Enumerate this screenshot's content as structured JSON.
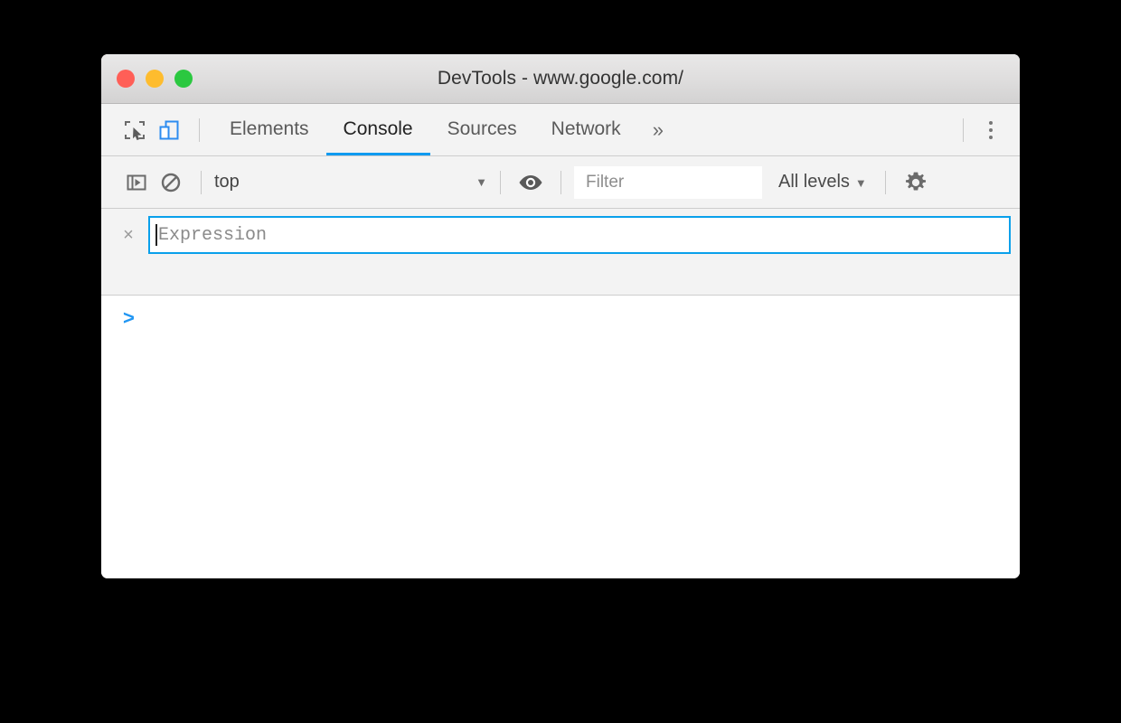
{
  "window": {
    "title": "DevTools - www.google.com/",
    "traffic_lights": [
      {
        "name": "close",
        "color": "#ff5f57"
      },
      {
        "name": "minimize",
        "color": "#febc2e"
      },
      {
        "name": "zoom",
        "color": "#2bc840"
      }
    ]
  },
  "tabbar": {
    "inspect_icon": "inspect-element-icon",
    "device_icon": "device-toolbar-icon",
    "tabs": [
      {
        "label": "Elements",
        "active": false
      },
      {
        "label": "Console",
        "active": true
      },
      {
        "label": "Sources",
        "active": false
      },
      {
        "label": "Network",
        "active": false
      }
    ],
    "overflow_label": "»",
    "more_menu": "more-options-icon",
    "active_underline_color": "#0f9af0"
  },
  "console_toolbar": {
    "sidebar_toggle_icon": "console-sidebar-toggle-icon",
    "clear_icon": "clear-console-icon",
    "context_value": "top",
    "context_caret": "▼",
    "live_expression_icon": "eye-icon",
    "filter_placeholder": "Filter",
    "filter_value": "",
    "levels_label": "All levels",
    "levels_caret": "▼",
    "settings_icon": "gear-icon"
  },
  "live_expression": {
    "close_label": "×",
    "placeholder": "Expression",
    "value": ""
  },
  "console_output": {
    "prompt": ">"
  }
}
